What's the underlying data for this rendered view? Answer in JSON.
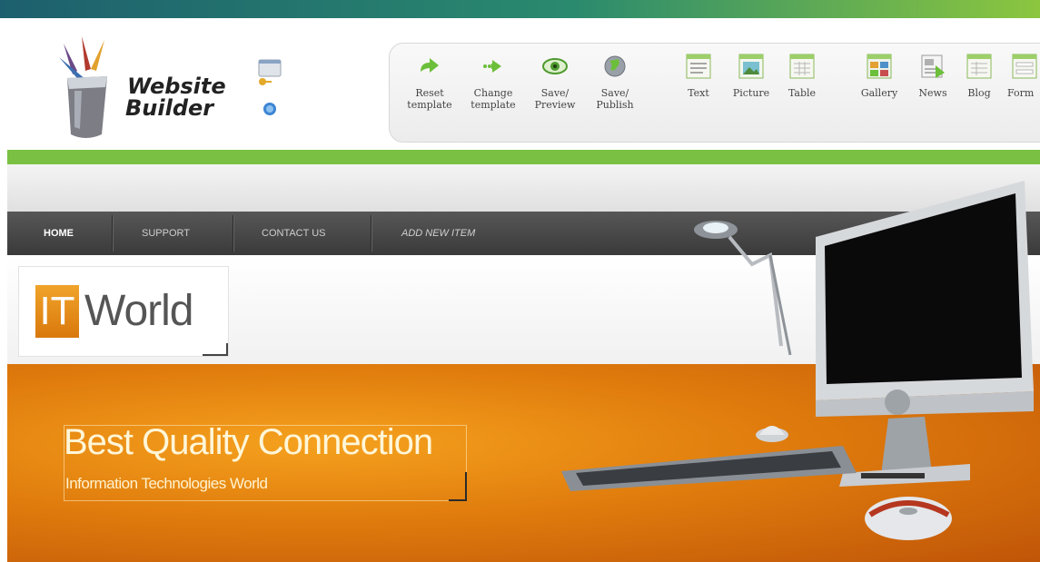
{
  "colors": {
    "top_stripe_start": "#1d5f6e",
    "top_stripe_end": "#8cc63f",
    "green_bar": "#7ac143",
    "nav_bg": "#444444",
    "banner_orange": "#e07c0d",
    "it_box_orange": "#e8900f"
  },
  "app": {
    "logo_line1": "Website",
    "logo_line2": "Builder",
    "logo_icon": "paint-bucket-brushes-icon",
    "side_icons": [
      "key-window-icon",
      "help-info-icon"
    ]
  },
  "toolbar": {
    "items": [
      {
        "line1": "Reset",
        "line2": "template",
        "icon": "arrow-right-icon"
      },
      {
        "line1": "Change",
        "line2": "template",
        "icon": "dotted-arrow-icon"
      },
      {
        "line1": "Save/",
        "line2": "Preview",
        "icon": "eye-icon"
      },
      {
        "line1": "Save/",
        "line2": "Publish",
        "icon": "globe-icon"
      },
      {
        "line1": "Text",
        "line2": "",
        "icon": "text-block-icon"
      },
      {
        "line1": "Picture",
        "line2": "",
        "icon": "picture-block-icon"
      },
      {
        "line1": "Table",
        "line2": "",
        "icon": "table-block-icon"
      },
      {
        "line1": "Gallery",
        "line2": "",
        "icon": "gallery-block-icon"
      },
      {
        "line1": "News",
        "line2": "",
        "icon": "news-block-icon"
      },
      {
        "line1": "Blog",
        "line2": "",
        "icon": "blog-block-icon"
      },
      {
        "line1": "Form",
        "line2": "",
        "icon": "form-block-icon"
      }
    ]
  },
  "site": {
    "nav": [
      "HOME",
      "SUPPORT",
      "CONTACT US",
      "ADD NEW ITEM"
    ],
    "logo_it": "IT",
    "logo_world": "World",
    "slogan_title": "Best Quality Connection",
    "slogan_subtitle": "Information Technologies World"
  }
}
